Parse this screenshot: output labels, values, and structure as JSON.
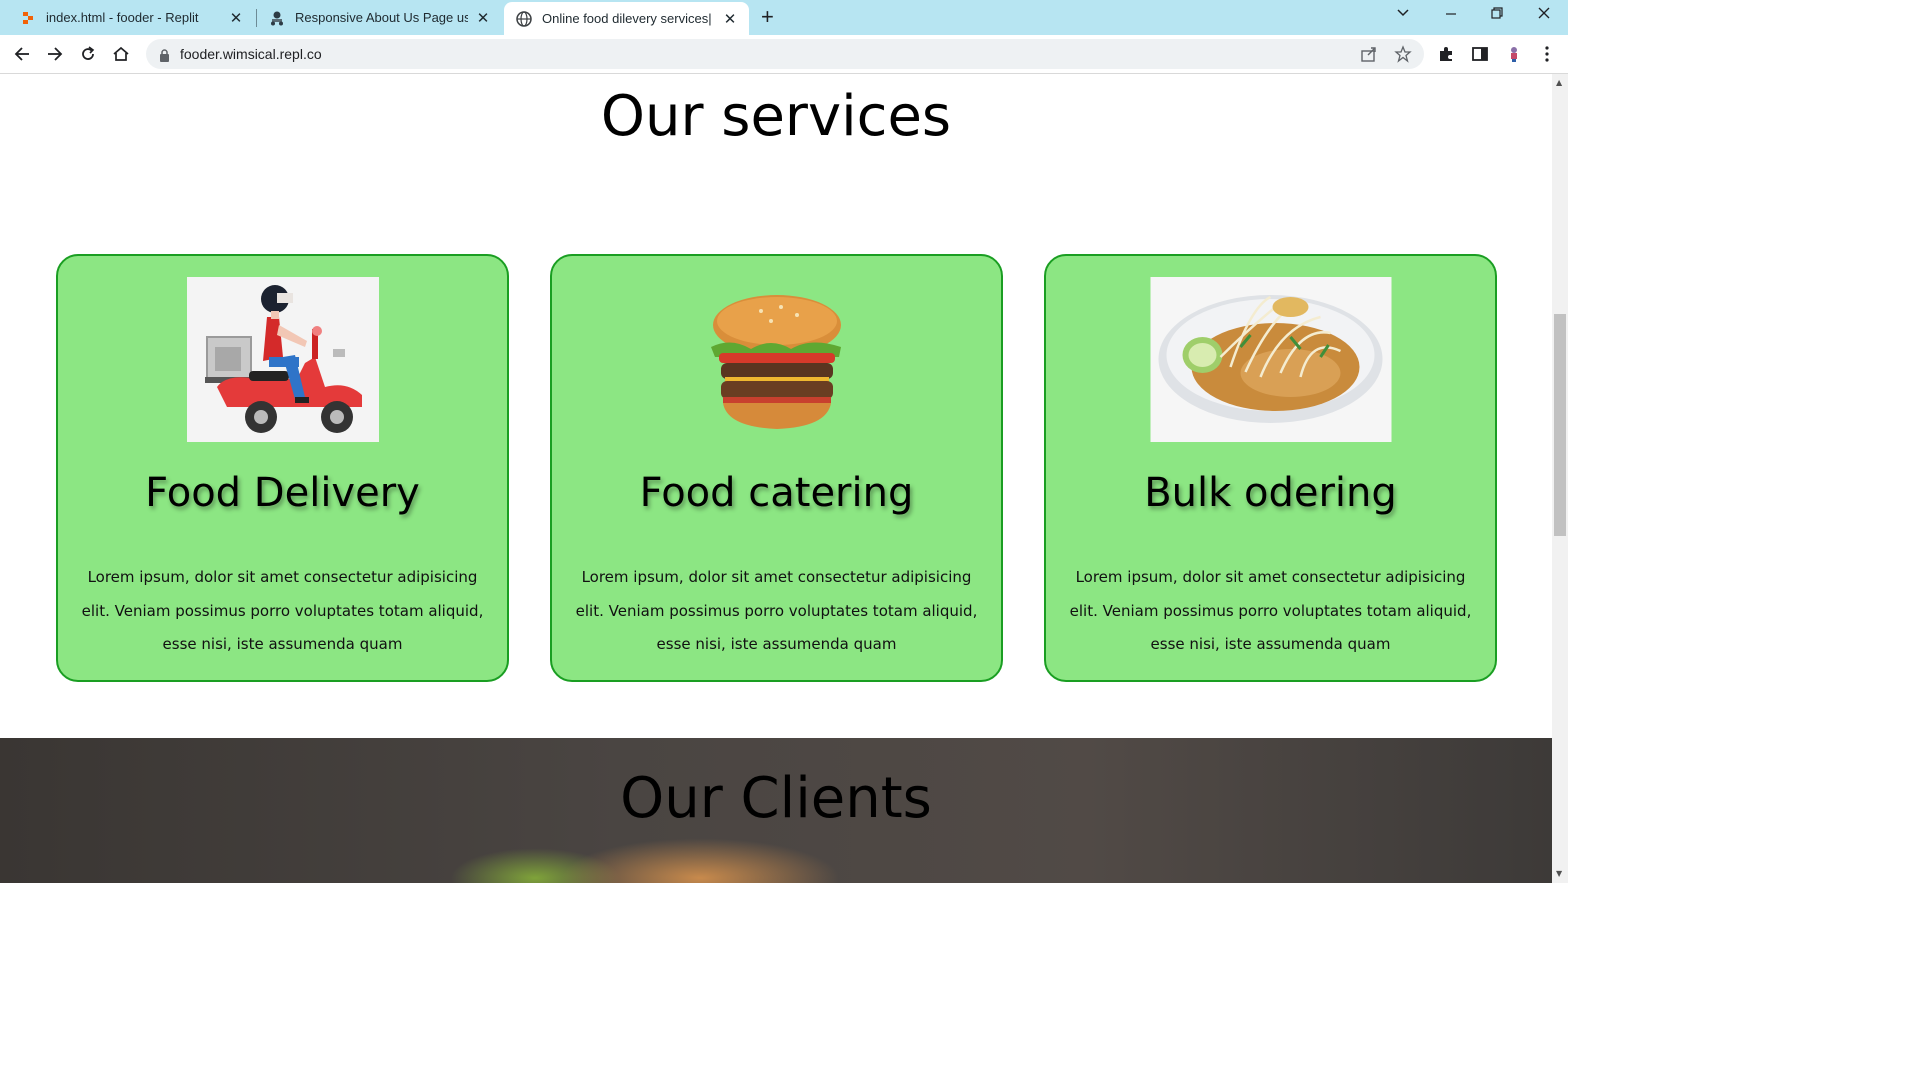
{
  "browser": {
    "tabs": [
      {
        "title": "index.html - fooder - Replit",
        "close": "✕",
        "favicon": "replit-icon"
      },
      {
        "title": "Responsive About Us Page using",
        "close": "✕",
        "favicon": "delivery-icon"
      },
      {
        "title": "Online food dilevery services| onl",
        "close": "✕",
        "favicon": "globe-icon"
      }
    ],
    "new_tab": "+",
    "url": "fooder.wimsical.repl.co"
  },
  "page": {
    "section_title": "Our services",
    "cards": [
      {
        "title": "Food Delivery",
        "image": "scooter-delivery-illustration",
        "text": "Lorem ipsum, dolor sit amet consectetur adipisicing elit. Veniam possimus porro voluptates totam aliquid, esse nisi, iste assumenda quam"
      },
      {
        "title": "Food catering",
        "image": "burger-photo",
        "text": "Lorem ipsum, dolor sit amet consectetur adipisicing elit. Veniam possimus porro voluptates totam aliquid, esse nisi, iste assumenda quam"
      },
      {
        "title": "Bulk odering",
        "image": "noodle-bowl-photo",
        "text": "Lorem ipsum, dolor sit amet consectetur adipisicing elit. Veniam possimus porro voluptates totam aliquid, esse nisi, iste assumenda quam"
      }
    ],
    "clients_title": "Our Clients"
  },
  "colors": {
    "card_bg": "#8ce683",
    "card_border": "#1a9e22",
    "tabbar": "#b7e5f2"
  }
}
